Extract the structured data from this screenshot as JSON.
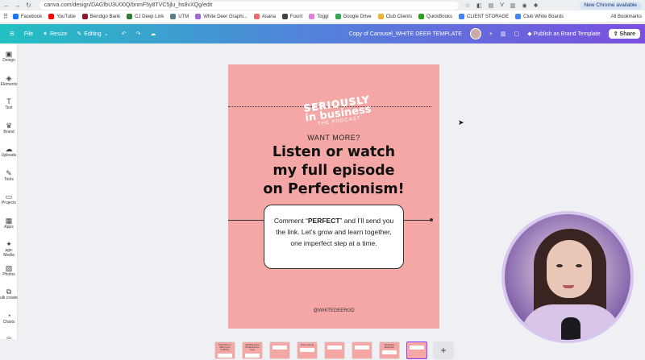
{
  "browser": {
    "url": "canva.com/design/DAGfbU3U00Q/bnmF5y8TVC5jlu_hs8vXQg/edit",
    "update_label": "New Chrome available",
    "nav_back": "←",
    "nav_forward": "→",
    "nav_reload": "↻"
  },
  "bookmarks": [
    {
      "label": "Facebook",
      "color": "#1877f2"
    },
    {
      "label": "YouTube",
      "color": "#ff0000"
    },
    {
      "label": "Bendigo Bank",
      "color": "#8b1a2b"
    },
    {
      "label": "CJ Deep Link",
      "color": "#2e7d32"
    },
    {
      "label": "UTM",
      "color": "#607d8b"
    },
    {
      "label": "White Deer Graphi...",
      "color": "#9c6bd3"
    },
    {
      "label": "Asana",
      "color": "#f06a6a"
    },
    {
      "label": "Fount",
      "color": "#444444"
    },
    {
      "label": "Toggl",
      "color": "#e57cd8"
    },
    {
      "label": "Google Drive",
      "color": "#34a853"
    },
    {
      "label": "Club Clients",
      "color": "#f2b134"
    },
    {
      "label": "QuickBooks",
      "color": "#2ca01c"
    },
    {
      "label": "CLIENT STORAGE",
      "color": "#4285f4"
    },
    {
      "label": "Club White Boards",
      "color": "#4285f4"
    }
  ],
  "all_bookmarks": "All Bookmarks",
  "toolbar": {
    "menu_icon": "≡",
    "file": "File",
    "resize": "Resize",
    "editing": "Editing",
    "doc_title": "Copy of Carousel_WHITE DEER TEMPLATE",
    "publish": "Publish as Brand Template",
    "share": "Share"
  },
  "sidebar": [
    {
      "label": "Design",
      "icon": "▣"
    },
    {
      "label": "Elements",
      "icon": "◈"
    },
    {
      "label": "Text",
      "icon": "T"
    },
    {
      "label": "Brand",
      "icon": "♛"
    },
    {
      "label": "Uploads",
      "icon": "☁"
    },
    {
      "label": "Tools",
      "icon": "✎"
    },
    {
      "label": "Projects",
      "icon": "▭"
    },
    {
      "label": "Apps",
      "icon": "▦"
    },
    {
      "label": "agic Media",
      "icon": "✦"
    },
    {
      "label": "Photos",
      "icon": "▨"
    },
    {
      "label": "ulk create",
      "icon": "⧉"
    },
    {
      "label": "Charts",
      "icon": "◔"
    },
    {
      "label": "",
      "icon": "◎"
    }
  ],
  "design": {
    "logo_line1": "SERIOUSLY",
    "logo_line2": "in business",
    "logo_line3": "THE PODCAST",
    "want_more": "WANT MORE?",
    "headline_1": "Listen or watch",
    "headline_2": "my full episode",
    "headline_3": "on Perfectionism!",
    "quote_before": "Comment “",
    "quote_bold": "PERFECT",
    "quote_after": "” and I’ll send you the link. Let’s grow and learn together, one imperfect step at a time.",
    "handle": "@WHITEDEERGD",
    "bg_color": "#f4a7a5"
  },
  "thumbnails": [
    {
      "label": "Perfection is killing your business"
    },
    {
      "label": "Identifying the Perfectionism Type"
    },
    {
      "label": ""
    },
    {
      "label": "How to let go"
    },
    {
      "label": ""
    },
    {
      "label": ""
    },
    {
      "label": "Perfection Reflection"
    },
    {
      "label": ""
    }
  ],
  "add_page": "+"
}
